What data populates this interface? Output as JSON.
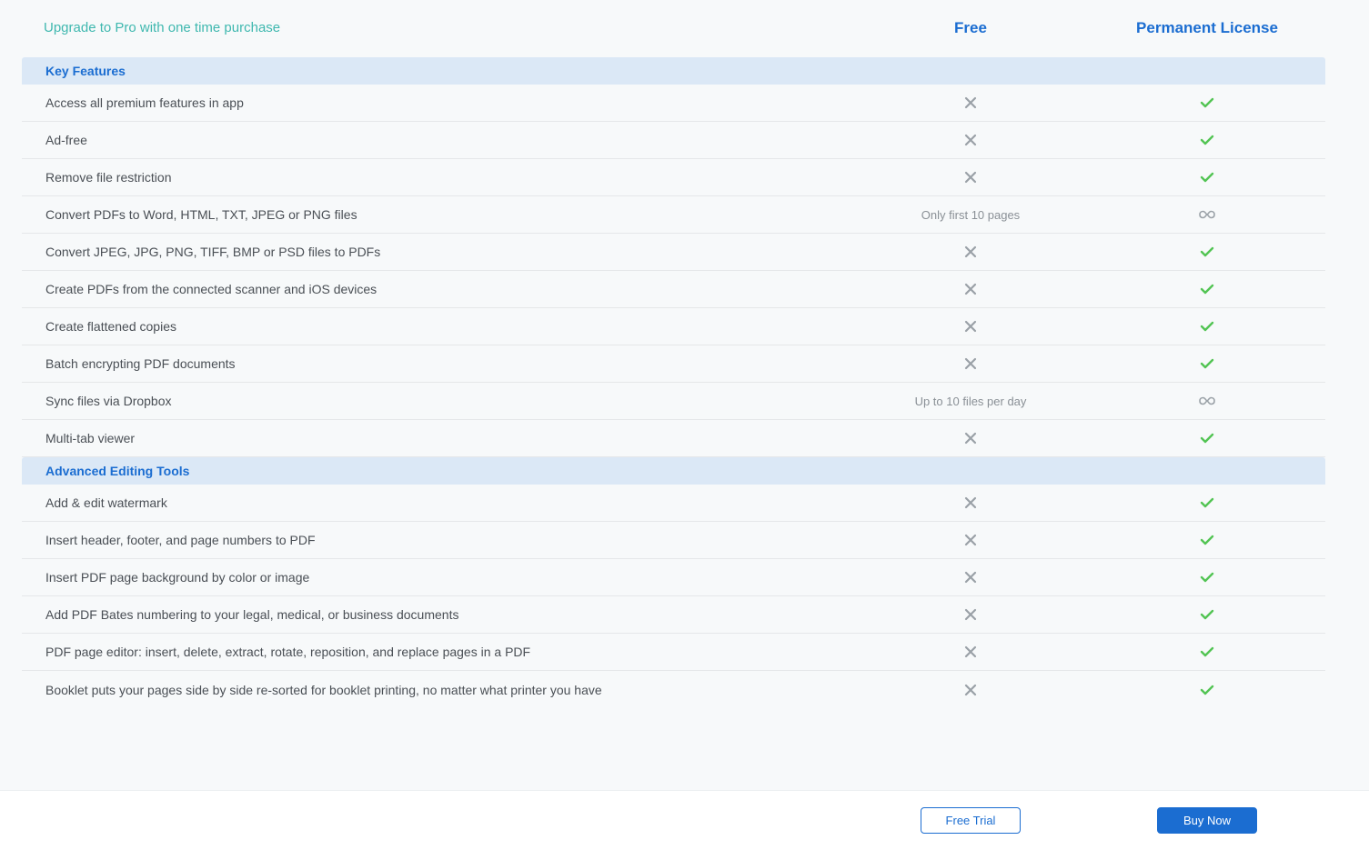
{
  "header": {
    "title": "Upgrade to Pro with one time purchase",
    "plans": [
      "Free",
      "Permanent License"
    ]
  },
  "sections": [
    {
      "title": "Key Features",
      "rows": [
        {
          "label": "Access all premium features in app",
          "free": "cross",
          "pro": "check"
        },
        {
          "label": "Ad-free",
          "free": "cross",
          "pro": "check"
        },
        {
          "label": "Remove file restriction",
          "free": "cross",
          "pro": "check"
        },
        {
          "label": "Convert PDFs to Word, HTML,  TXT, JPEG or PNG files",
          "free": "text:Only first 10 pages",
          "pro": "infinity"
        },
        {
          "label": "Convert JPEG, JPG, PNG, TIFF, BMP or PSD files to PDFs",
          "free": "cross",
          "pro": "check"
        },
        {
          "label": "Create PDFs from the connected scanner and iOS devices",
          "free": "cross",
          "pro": "check"
        },
        {
          "label": "Create flattened copies",
          "free": "cross",
          "pro": "check"
        },
        {
          "label": "Batch encrypting PDF documents",
          "free": "cross",
          "pro": "check"
        },
        {
          "label": "Sync files via Dropbox",
          "free": "text:Up to 10 files per day",
          "pro": "infinity"
        },
        {
          "label": "Multi-tab viewer",
          "free": "cross",
          "pro": "check"
        }
      ]
    },
    {
      "title": "Advanced Editing Tools",
      "rows": [
        {
          "label": "Add & edit watermark",
          "free": "cross",
          "pro": "check"
        },
        {
          "label": "Insert header, footer, and page numbers to PDF",
          "free": "cross",
          "pro": "check"
        },
        {
          "label": "Insert PDF page background by color or image",
          "free": "cross",
          "pro": "check"
        },
        {
          "label": "Add PDF Bates numbering to your legal, medical, or business documents",
          "free": "cross",
          "pro": "check"
        },
        {
          "label": "PDF page editor: insert, delete, extract, rotate, reposition, and replace pages in a PDF",
          "free": "cross",
          "pro": "check"
        },
        {
          "label": "Booklet puts your pages side by side re-sorted for booklet printing, no matter what printer you have",
          "free": "cross",
          "pro": "check"
        }
      ]
    }
  ],
  "footer": {
    "free_button": "Free Trial",
    "pro_button": "Buy Now"
  }
}
